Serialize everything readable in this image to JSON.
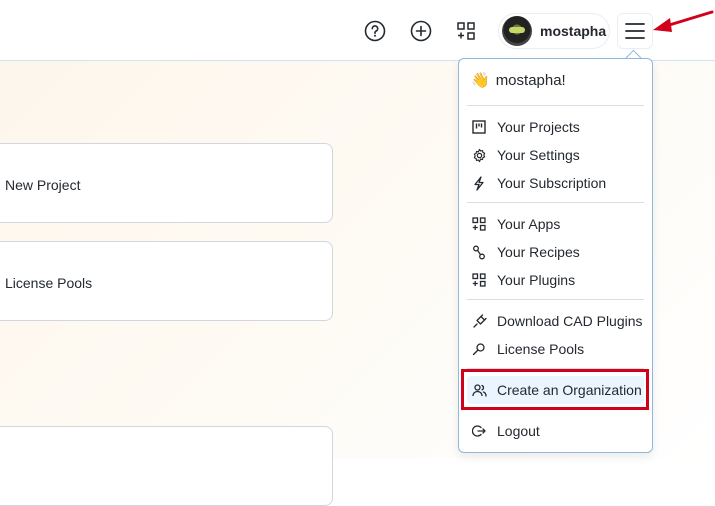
{
  "topbar": {
    "help_icon": "question-circle-icon",
    "add_icon": "plus-circle-icon",
    "apps_icon": "apps-grid-icon",
    "username": "mostapha",
    "menu_icon": "hamburger-icon"
  },
  "main": {
    "cards": [
      {
        "label": "New Project"
      },
      {
        "label": "License Pools"
      },
      {
        "label": ""
      }
    ]
  },
  "dropdown": {
    "greeting_emoji": "👋",
    "greeting": "mostapha!",
    "items": [
      {
        "label": "Your Projects",
        "icon": "project-board-icon"
      },
      {
        "label": "Your Settings",
        "icon": "gear-icon"
      },
      {
        "label": "Your Subscription",
        "icon": "lightning-icon"
      },
      {
        "label": "Your Apps",
        "icon": "apps-icon"
      },
      {
        "label": "Your Recipes",
        "icon": "recipe-icon"
      },
      {
        "label": "Your Plugins",
        "icon": "plugins-icon"
      },
      {
        "label": "Download CAD Plugins",
        "icon": "plug-icon"
      },
      {
        "label": "License Pools",
        "icon": "key-icon"
      },
      {
        "label": "Create an Organization",
        "icon": "people-icon"
      },
      {
        "label": "Logout",
        "icon": "logout-icon"
      }
    ]
  },
  "annotation": {
    "highlight_color": "#d0021b",
    "arrow_color": "#d0021b"
  }
}
